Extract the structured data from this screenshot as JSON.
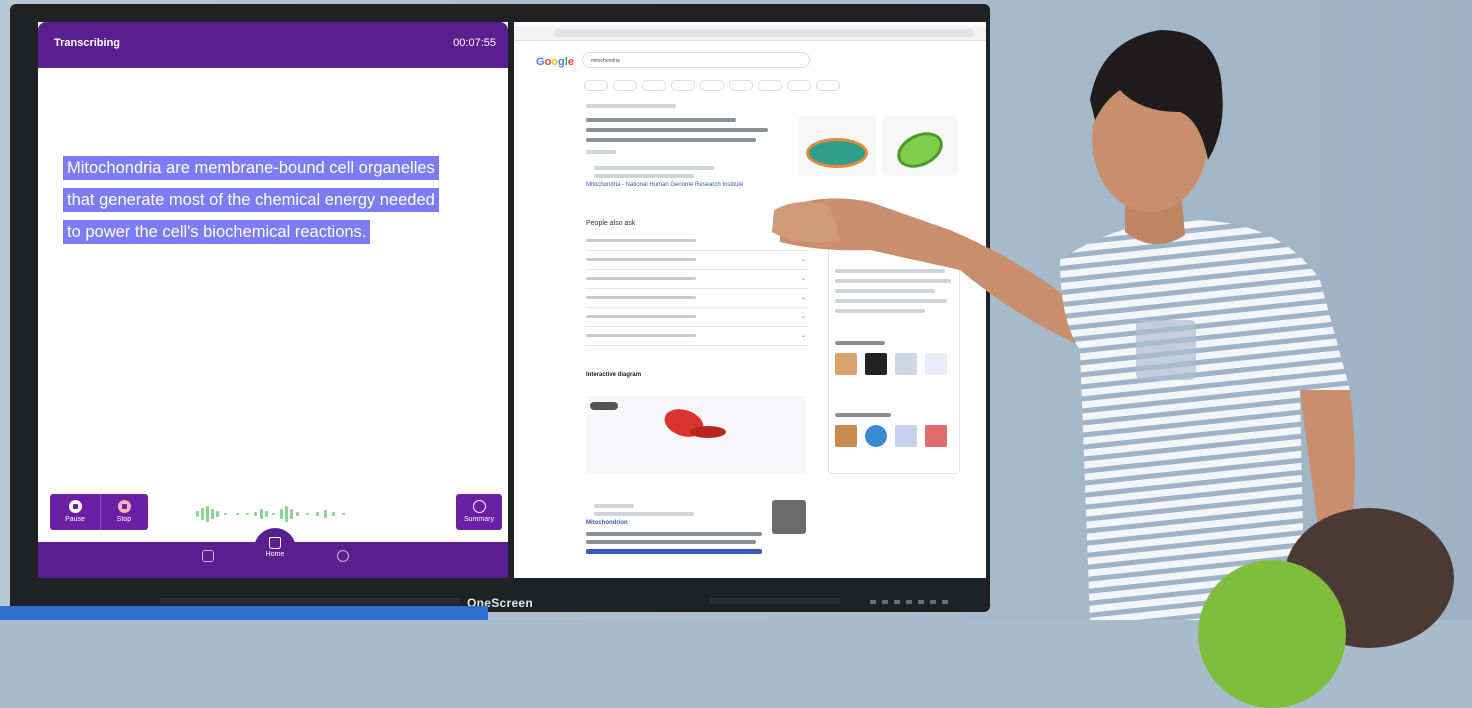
{
  "app": {
    "status": "Transcribing",
    "timer": "00:07:55",
    "transcript": [
      "Mitochondria are membrane-bound cell organelles",
      "that generate most of the chemical energy needed",
      "to power the cell's biochemical reactions."
    ],
    "controls": {
      "pause": "Pause",
      "stop": "Stop",
      "summary": "Summary"
    },
    "nav": {
      "home": "Home"
    }
  },
  "browser": {
    "logo": "Google",
    "query": "mitochondria",
    "link_nih": "Mitochondria - National Human Genome Research Institute",
    "people_also_ask": "People also ask",
    "interactive_diagram": "Interactive diagram",
    "wiki_title": "Mitochondrion"
  },
  "monitor": {
    "brand": "OneScreen"
  },
  "colors": {
    "app_purple": "#5a1f8f",
    "highlight": "#7e7cf2",
    "monitor_frame": "#1f2124"
  }
}
